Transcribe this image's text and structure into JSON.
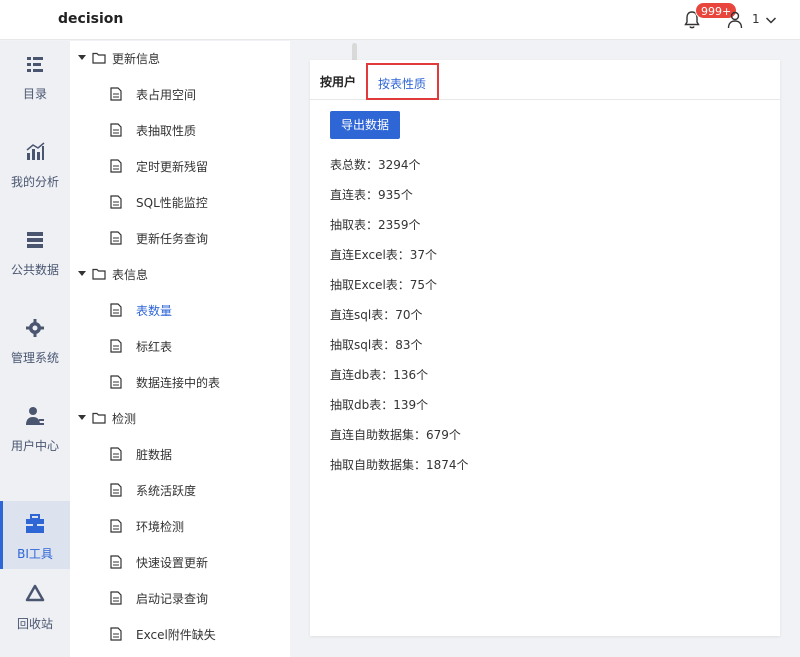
{
  "header": {
    "brand": "decision",
    "notification_badge": "999+",
    "user_name": "1"
  },
  "leftnav": {
    "items": [
      {
        "label": "目录",
        "icon": "catalog-icon"
      },
      {
        "label": "我的分析",
        "icon": "analysis-icon"
      },
      {
        "label": "公共数据",
        "icon": "public-data-icon"
      },
      {
        "label": "管理系统",
        "icon": "gear-icon"
      },
      {
        "label": "用户中心",
        "icon": "user-center-icon"
      },
      {
        "label": "BI工具",
        "icon": "toolbox-icon",
        "active": true
      },
      {
        "label": "回收站",
        "icon": "recycle-icon"
      }
    ]
  },
  "tree": {
    "groups": [
      {
        "label": "更新信息",
        "items": [
          "表占用空间",
          "表抽取性质",
          "定时更新残留",
          "SQL性能监控",
          "更新任务查询"
        ]
      },
      {
        "label": "表信息",
        "items": [
          "表数量",
          "标红表",
          "数据连接中的表"
        ]
      },
      {
        "label": "检测",
        "items": [
          "脏数据",
          "系统活跃度",
          "环境检测",
          "快速设置更新",
          "启动记录查询",
          "Excel附件缺失"
        ]
      }
    ],
    "selected": "表数量"
  },
  "panel": {
    "tab_by_user": "按用户",
    "tab_by_table": "按表性质",
    "export_button": "导出数据",
    "stats": [
      "表总数：3294个",
      "直连表：935个",
      "抽取表：2359个",
      "直连Excel表：37个",
      "抽取Excel表：75个",
      "直连sql表：70个",
      "抽取sql表：83个",
      "直连db表：136个",
      "抽取db表：139个",
      "直连自助数据集：679个",
      "抽取自助数据集：1874个"
    ]
  },
  "colors": {
    "accent": "#2f66d6",
    "badge": "#e8453c",
    "highlight_border": "#e03a3a"
  }
}
